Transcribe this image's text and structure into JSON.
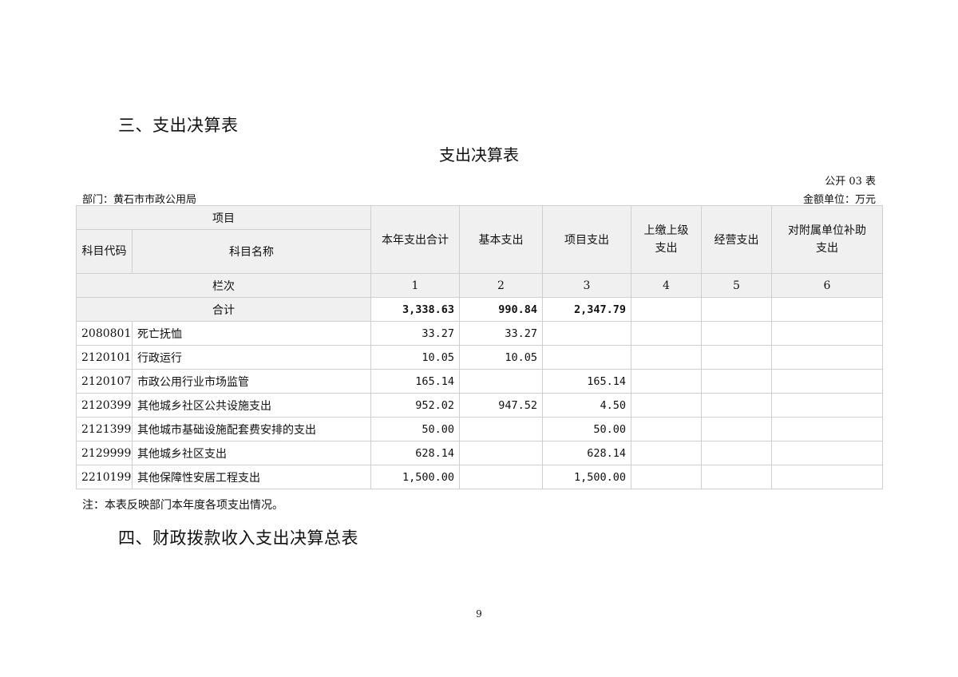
{
  "section_heading_1": "三、支出决算表",
  "table_title": "支出决算表",
  "table_code": "公开 03 表",
  "department": "部门：黄石市市政公用局",
  "unit": "金额单位：万元",
  "header": {
    "project": "项目",
    "subject_code": "科目代码",
    "subject_name": "科目名称",
    "total": "本年支出合计",
    "basic": "基本支出",
    "project_exp": "项目支出",
    "upper": "上缴上级支出",
    "business": "经营支出",
    "subsidy": "对附属单位补助支出",
    "column_index_label": "栏次",
    "column_numbers": [
      "1",
      "2",
      "3",
      "4",
      "5",
      "6"
    ]
  },
  "total_row": {
    "label": "合计",
    "values": [
      "3,338.63",
      "990.84",
      "2,347.79",
      "",
      "",
      ""
    ]
  },
  "rows": [
    {
      "code": "2080801",
      "name": "死亡抚恤",
      "values": [
        "33.27",
        "33.27",
        "",
        "",
        "",
        ""
      ]
    },
    {
      "code": "2120101",
      "name": "行政运行",
      "values": [
        "10.05",
        "10.05",
        "",
        "",
        "",
        ""
      ]
    },
    {
      "code": "2120107",
      "name": "市政公用行业市场监管",
      "values": [
        "165.14",
        "",
        "165.14",
        "",
        "",
        ""
      ]
    },
    {
      "code": "2120399",
      "name": "其他城乡社区公共设施支出",
      "values": [
        "952.02",
        "947.52",
        "4.50",
        "",
        "",
        ""
      ]
    },
    {
      "code": "2121399",
      "name": "其他城市基础设施配套费安排的支出",
      "values": [
        "50.00",
        "",
        "50.00",
        "",
        "",
        ""
      ]
    },
    {
      "code": "2129999",
      "name": "其他城乡社区支出",
      "values": [
        "628.14",
        "",
        "628.14",
        "",
        "",
        ""
      ]
    },
    {
      "code": "2210199",
      "name": "其他保障性安居工程支出",
      "values": [
        "1,500.00",
        "",
        "1,500.00",
        "",
        "",
        ""
      ]
    }
  ],
  "note": "注：本表反映部门本年度各项支出情况。",
  "section_heading_2": "四、财政拨款收入支出决算总表",
  "page_number": "9"
}
